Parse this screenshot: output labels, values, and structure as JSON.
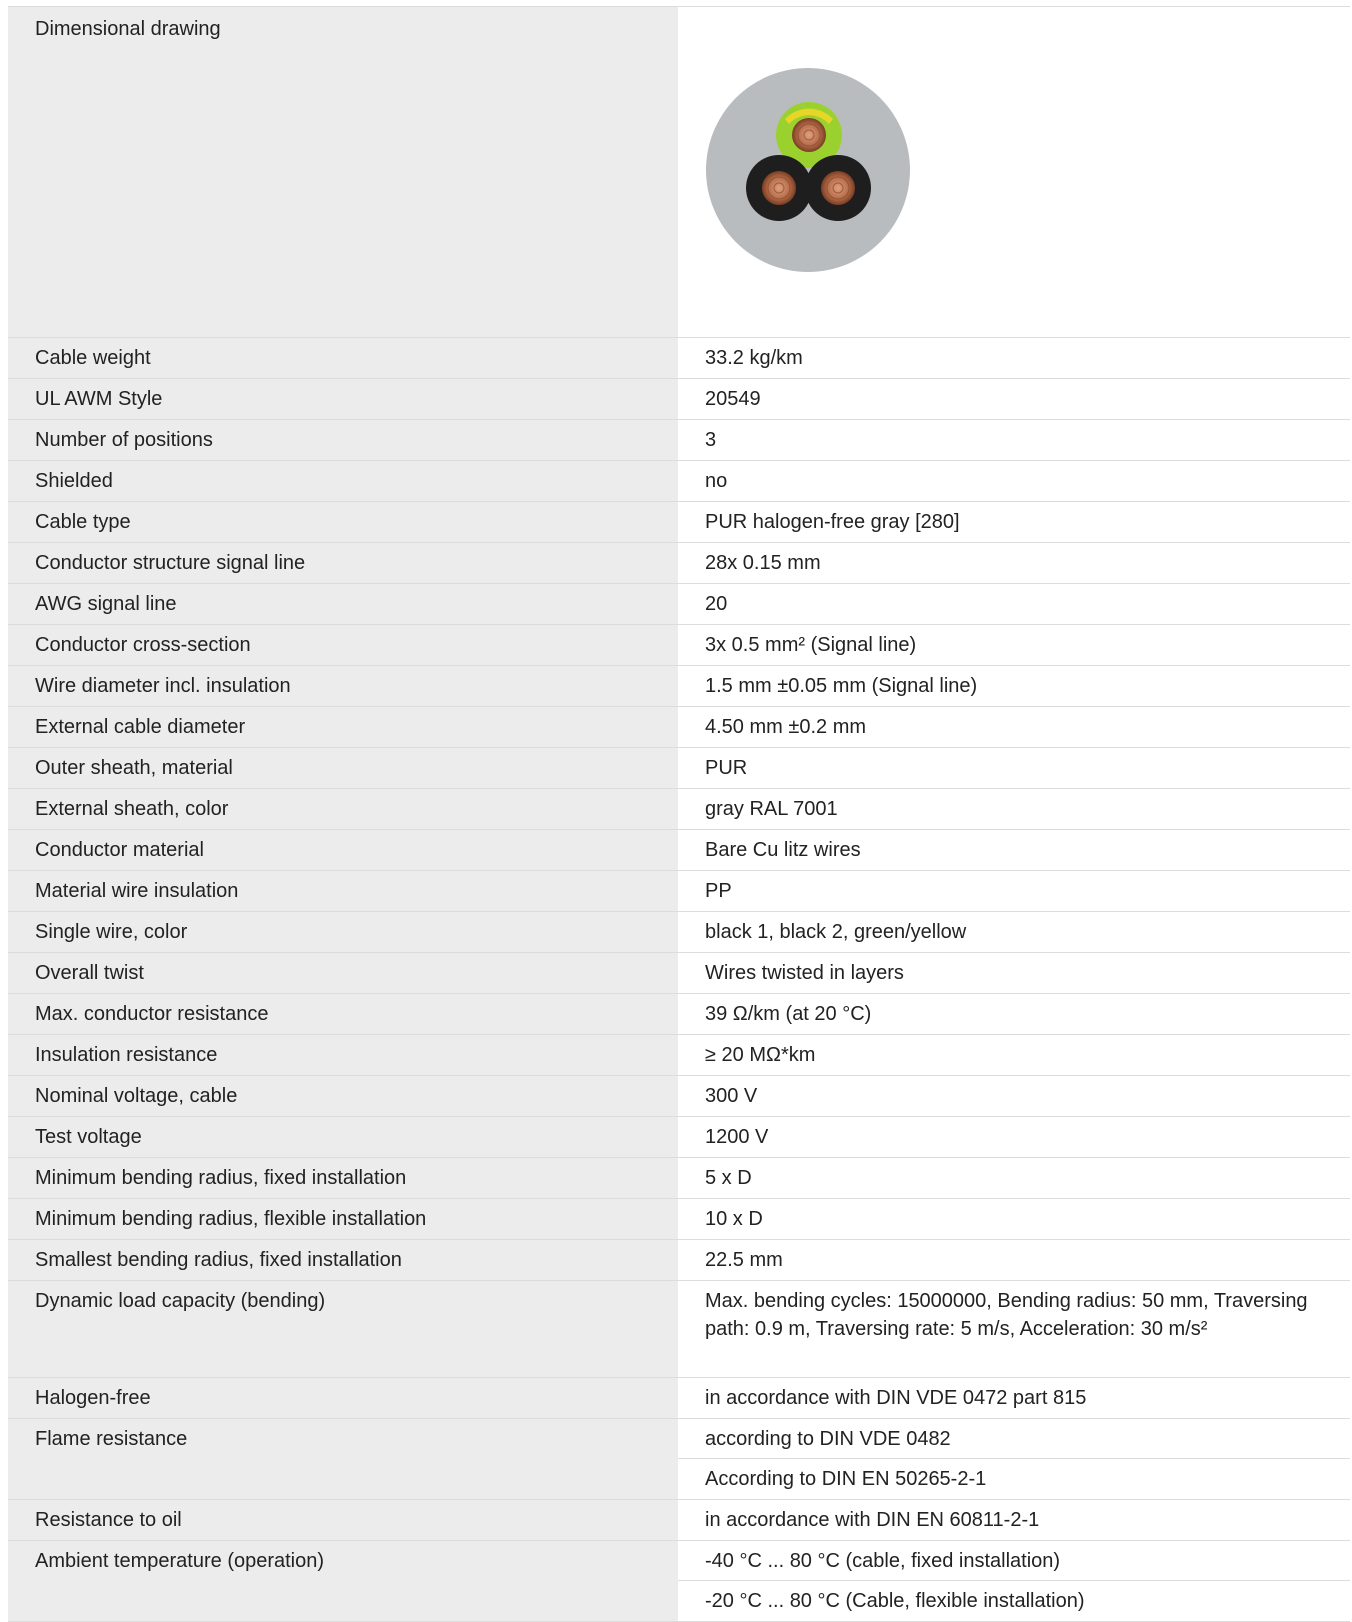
{
  "drawing": {
    "label": "Dimensional drawing",
    "colors": {
      "sheath": "#b9bcbf",
      "black_insulation": "#1e1e1e",
      "green_yellow": "#9bd12f",
      "copper": "#b86f4d"
    }
  },
  "rows": [
    {
      "label": "Cable weight",
      "value": "33.2 kg/km"
    },
    {
      "label": "UL AWM Style",
      "value": "20549"
    },
    {
      "label": "Number of positions",
      "value": "3"
    },
    {
      "label": "Shielded",
      "value": "no"
    },
    {
      "label": "Cable type",
      "value": "PUR halogen-free gray [280]"
    },
    {
      "label": "Conductor structure signal line",
      "value": "28x 0.15 mm"
    },
    {
      "label": "AWG signal line",
      "value": "20"
    },
    {
      "label": "Conductor cross-section",
      "value": "3x 0.5 mm² (Signal line)"
    },
    {
      "label": "Wire diameter incl. insulation",
      "value": "1.5 mm ±0.05 mm (Signal line)"
    },
    {
      "label": "External cable diameter",
      "value": "4.50 mm ±0.2 mm"
    },
    {
      "label": "Outer sheath, material",
      "value": "PUR"
    },
    {
      "label": "External sheath, color",
      "value": "gray RAL 7001"
    },
    {
      "label": "Conductor material",
      "value": "Bare Cu litz wires"
    },
    {
      "label": "Material wire insulation",
      "value": "PP"
    },
    {
      "label": "Single wire, color",
      "value": "black 1, black 2, green/yellow"
    },
    {
      "label": "Overall twist",
      "value": "Wires twisted in layers"
    },
    {
      "label": "Max. conductor resistance",
      "value": "39 Ω/km (at 20 °C)"
    },
    {
      "label": "Insulation resistance",
      "value": "≥ 20 MΩ*km"
    },
    {
      "label": "Nominal voltage, cable",
      "value": "300 V"
    },
    {
      "label": "Test voltage",
      "value": "1200 V"
    },
    {
      "label": "Minimum bending radius, fixed installation",
      "value": "5 x D"
    },
    {
      "label": "Minimum bending radius, flexible installation",
      "value": "10 x D"
    },
    {
      "label": "Smallest bending radius, fixed installation",
      "value": "22.5 mm"
    }
  ],
  "dynamic_load": {
    "label": "Dynamic load capacity (bending)",
    "value": "Max. bending cycles: 15000000, Bending radius: 50 mm, Traversing path: 0.9 m, Traversing rate: 5 m/s, Acceleration: 30 m/s²"
  },
  "halogen_free": {
    "label": "Halogen-free",
    "value": "in accordance with DIN VDE 0472 part 815"
  },
  "flame_resistance": {
    "label": "Flame resistance",
    "values": [
      "according to DIN VDE 0482",
      "According to DIN EN 50265-2-1"
    ]
  },
  "oil_resistance": {
    "label": "Resistance to oil",
    "value": "in accordance with DIN EN 60811-2-1"
  },
  "ambient_temperature": {
    "label": "Ambient temperature (operation)",
    "values": [
      "-40 °C ... 80 °C (cable, fixed installation)",
      "-20 °C ... 80 °C (Cable, flexible installation)"
    ]
  }
}
